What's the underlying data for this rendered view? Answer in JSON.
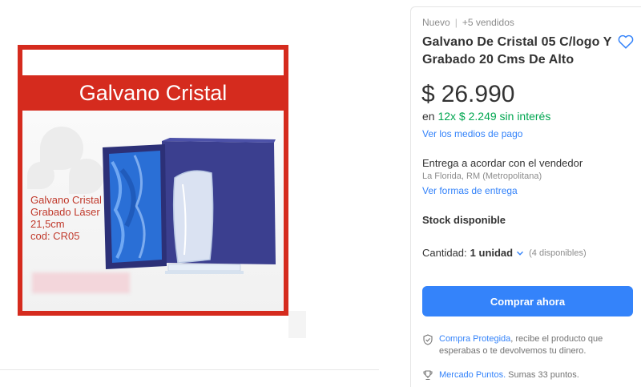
{
  "gallery": {
    "banner_text": "Galvano Cristal",
    "caption_lines": [
      "Galvano Cristal",
      "Grabado Láser",
      "21,5cm",
      "cod: CR05"
    ]
  },
  "product": {
    "condition": "Nuevo",
    "sold": "+5 vendidos",
    "title": "Galvano De Cristal 05 C/logo Y Grabado 20 Cms De Alto",
    "price_symbol": "$",
    "price": "26.990",
    "installments_prefix": "en",
    "installments": "12x $ 2.249 sin interés",
    "payment_link": "Ver los medios de pago"
  },
  "delivery": {
    "text": "Entrega a acordar con el vendedor",
    "location": "La Florida, RM (Metropolitana)",
    "link": "Ver formas de entrega"
  },
  "stock": {
    "label": "Stock disponible",
    "quantity_label": "Cantidad:",
    "quantity_value": "1 unidad",
    "available": "(4 disponibles)"
  },
  "actions": {
    "buy_now": "Comprar ahora"
  },
  "protection": {
    "link": "Compra Protegida",
    "text": ", recibe el producto que esperabas o te devolvemos tu dinero."
  },
  "points": {
    "link": "Mercado Puntos.",
    "text": "Sumas 33 puntos."
  },
  "colors": {
    "accent_blue": "#3483fa",
    "green": "#00a650",
    "image_red": "#d52b1e"
  },
  "icons": {
    "favorite": "heart-icon",
    "quantity": "chevron-down-icon",
    "protection": "shield-check-icon",
    "points": "trophy-icon"
  }
}
